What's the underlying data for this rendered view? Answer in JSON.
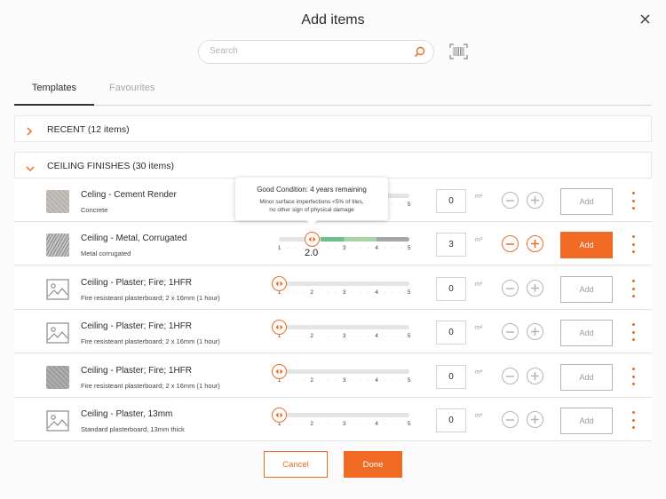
{
  "dialog": {
    "title": "Add items"
  },
  "search": {
    "placeholder": "Search",
    "value": ""
  },
  "tabs": [
    {
      "label": "Templates",
      "active": true
    },
    {
      "label": "Favourites",
      "active": false
    }
  ],
  "sections": [
    {
      "label": "RECENT (12 items)",
      "expanded": false
    },
    {
      "label": "CEILING FINISHES (30 items)",
      "expanded": true
    }
  ],
  "condition_scale": [
    "1",
    "2",
    "3",
    "4",
    "5"
  ],
  "items": [
    {
      "name": "Celing - Cement Render",
      "description": "Concrete",
      "quantity": "0",
      "unit": "m²",
      "add_label": "Add",
      "thumb": "concrete",
      "condition": 1.0,
      "active": false
    },
    {
      "name": "Ceiling - Metal, Corrugated",
      "description": "Metal corrugated",
      "quantity": "3",
      "unit": "m²",
      "add_label": "Add",
      "thumb": "corrugated",
      "condition": 2.0,
      "condition_label": "2.0",
      "active": true
    },
    {
      "name": "Ceiling - Plaster; Fire; 1HFR",
      "description": "Fire resisteant plasterboard; 2 x 16mm (1 hour)",
      "quantity": "0",
      "unit": "m²",
      "add_label": "Add",
      "thumb": "placeholder-image-icon",
      "condition": 1.0,
      "active": false
    },
    {
      "name": "Ceiling - Plaster; Fire; 1HFR",
      "description": "Fire resisteant plasterboard; 2 x 16mm (1 hour)",
      "quantity": "0",
      "unit": "m²",
      "add_label": "Add",
      "thumb": "placeholder-image-icon",
      "condition": 1.0,
      "active": false
    },
    {
      "name": "Ceiling - Plaster; Fire; 1HFR",
      "description": "Fire resisteant plasterboard; 2 x 16mm (1 hour)",
      "quantity": "0",
      "unit": "m²",
      "add_label": "Add",
      "thumb": "plaster",
      "condition": 1.0,
      "active": false
    },
    {
      "name": "Ceiling - Plaster, 13mm",
      "description": "Standard plasterboard, 13mm thick",
      "quantity": "0",
      "unit": "m²",
      "add_label": "Add",
      "thumb": "placeholder-image-icon",
      "condition": 1.0,
      "active": false
    }
  ],
  "tooltip": {
    "title": "Good Condition: 4 years remaining",
    "body_line1": "Minor surface imperfections <5% of tiles,",
    "body_line2": "no other sign of physical damage"
  },
  "footer": {
    "cancel_label": "Cancel",
    "done_label": "Done"
  },
  "colors": {
    "accent": "#f06a23",
    "condition_green": "#6fbf8a",
    "condition_light_green": "#a8d4a8",
    "condition_grey": "#a7a7a7"
  }
}
